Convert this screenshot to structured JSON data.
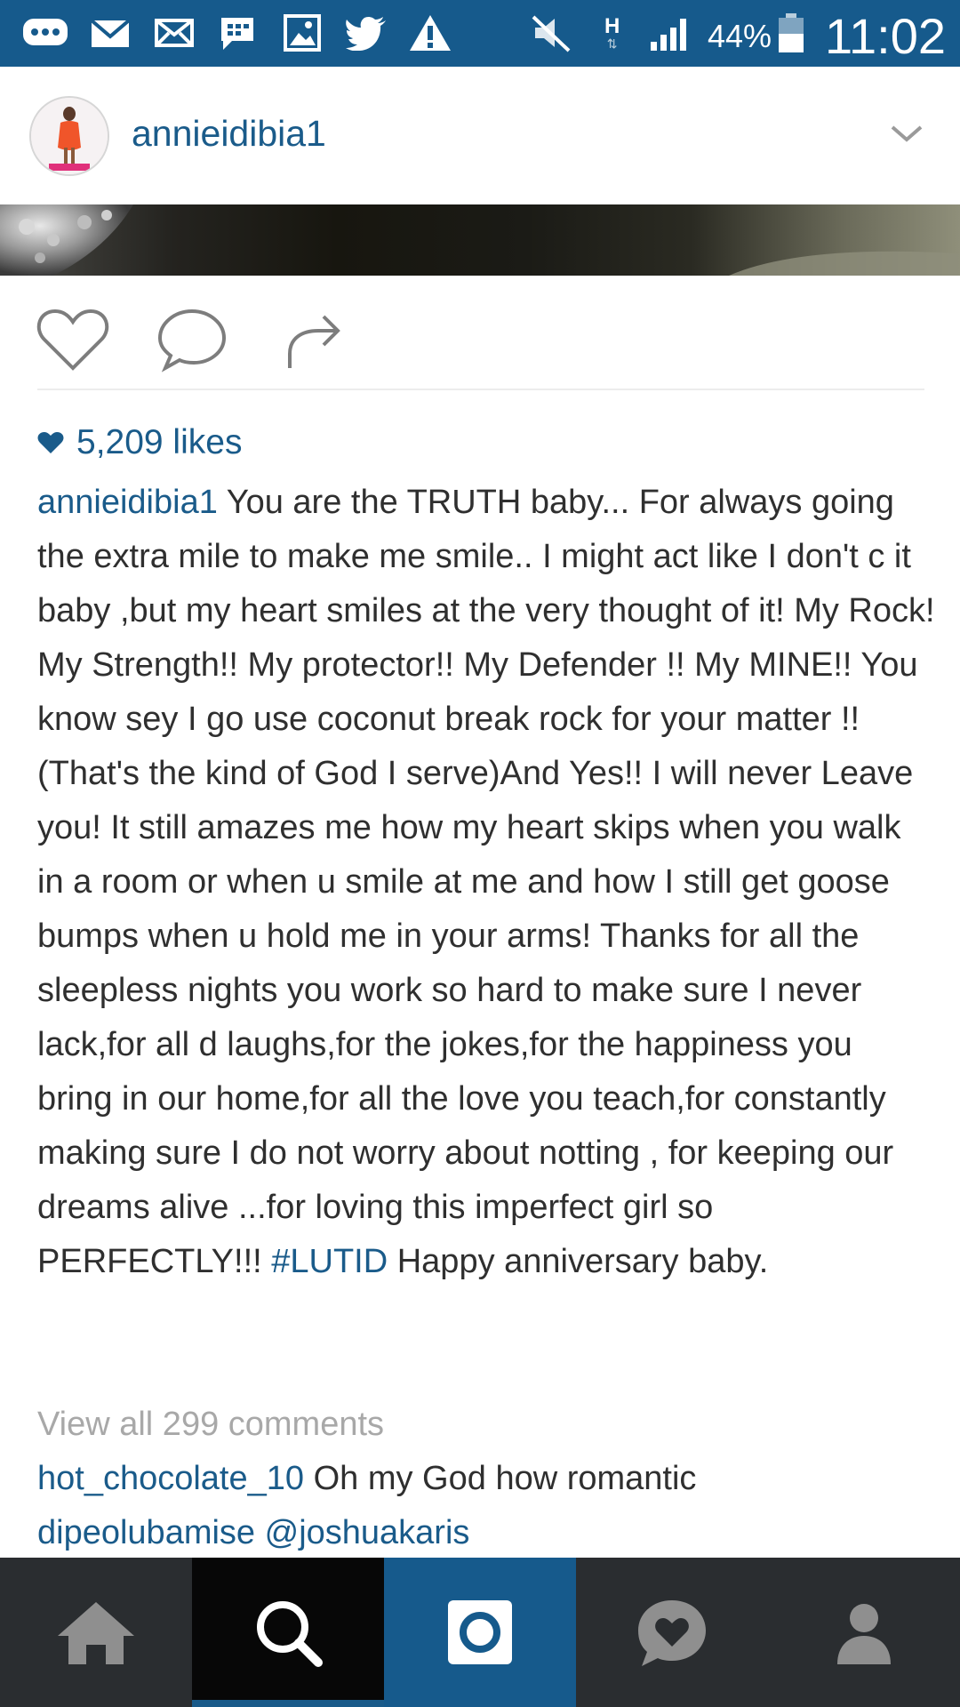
{
  "status_bar": {
    "battery_percent": "44%",
    "time": "11:02",
    "network_label": "H",
    "icons": [
      "chat-bubble-icon",
      "gmail-icon",
      "email-icon",
      "message-icon",
      "gallery-icon",
      "twitter-icon",
      "warning-icon",
      "mute-icon",
      "network-h-icon",
      "signal-icon",
      "battery-icon"
    ]
  },
  "post": {
    "username": "annieidibia1",
    "likes": "5,209 likes",
    "caption": {
      "user": "annieidibia1",
      "text_before_tag": "You are the TRUTH baby... For always going the extra mile to make me smile.. I might act like I don't c it baby ,but my heart smiles at the very thought of it! My Rock! My Strength!! My protector!! My Defender !! My MINE!! You know sey I go use coconut break rock for your matter !! (That's the kind of God I serve)And Yes!! I will never Leave you! It still amazes me how my heart skips when you walk in a room or when u smile at me and how I still get goose bumps when u hold me in your arms! Thanks for all the sleepless nights you work so hard to make sure I never lack,for all d laughs,for the jokes,for the happiness you bring in our home,for all the love you teach,for constantly making sure I do not worry about notting , for keeping our dreams alive ...for loving this imperfect girl so PERFECTLY!!!",
      "hashtag": "#LUTID",
      "text_after_tag": "Happy anniversary baby."
    },
    "view_all_comments": "View all 299 comments",
    "comments": [
      {
        "user": "hot_chocolate_10",
        "text": "Oh my God how romantic"
      },
      {
        "user": "dipeolubamise",
        "text": "@joshuakaris"
      }
    ]
  },
  "nav": {
    "tabs": [
      "home",
      "search",
      "camera",
      "activity",
      "profile"
    ],
    "active_tab": "search"
  },
  "colors": {
    "status_bar": "#165a8c",
    "link": "#1a5b8a",
    "nav_bg": "#2a2d30",
    "nav_active": "#070707",
    "camera_tab": "#165a8c"
  }
}
